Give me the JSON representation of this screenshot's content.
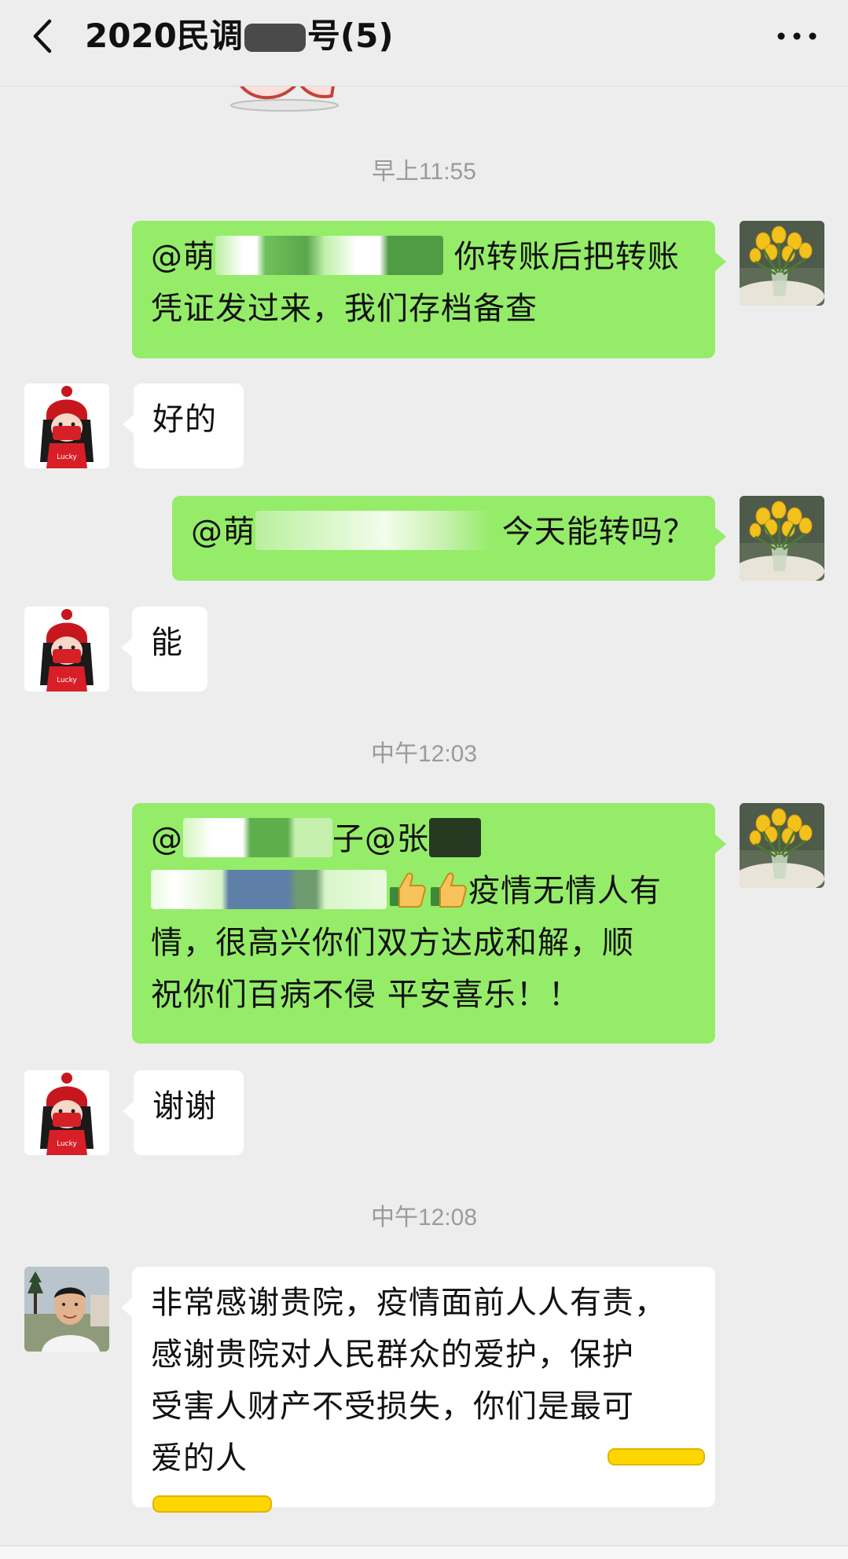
{
  "header": {
    "title_prefix": "2020民调",
    "title_suffix": "号(5)"
  },
  "colors": {
    "my_bubble": "#95ec69",
    "their_bubble": "#ffffff",
    "background": "#ededed",
    "highlight": "#ffd600"
  },
  "messages": [
    {
      "type": "time",
      "text": "早上11:55"
    },
    {
      "type": "outgoing",
      "avatar": "tulip-avatar",
      "parts": [
        "@萌",
        "你转账后把转账",
        "凭证发过来，我们存档备查"
      ]
    },
    {
      "type": "incoming",
      "avatar": "girl-avatar",
      "text": "好的"
    },
    {
      "type": "outgoing",
      "avatar": "tulip-avatar",
      "parts": [
        "@萌",
        "今天能转吗？"
      ]
    },
    {
      "type": "incoming",
      "avatar": "girl-avatar",
      "text": "能"
    },
    {
      "type": "time",
      "text": "中午12:03"
    },
    {
      "type": "outgoing",
      "avatar": "tulip-avatar",
      "parts": [
        "@",
        "子@张",
        "疫情无情人有",
        "情，很高兴你们双方达成和解，顺",
        "祝你们百病不侵 平安喜乐！！"
      ]
    },
    {
      "type": "incoming",
      "avatar": "girl-avatar",
      "text": "谢谢"
    },
    {
      "type": "time",
      "text": "中午12:08"
    },
    {
      "type": "incoming",
      "avatar": "man-avatar",
      "lines": [
        "非常感谢贵院，疫情面前人人有责，",
        "感谢贵院对人民群众的爱护，保护",
        "受害人财产不受损失，你们是最可",
        "爱的人"
      ]
    }
  ]
}
